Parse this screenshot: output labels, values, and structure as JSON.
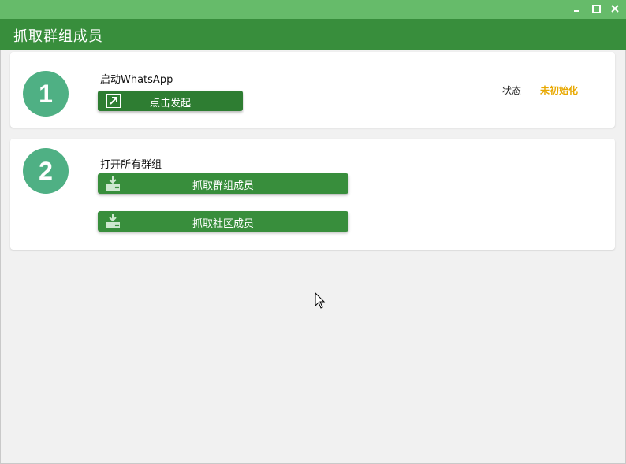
{
  "window": {
    "title_bar_color": "#66bb6a",
    "controls": {
      "minimize_icon": "minimize-icon",
      "maximize_icon": "maximize-icon",
      "close_icon": "close-icon"
    }
  },
  "header": {
    "title": "抓取群组成员",
    "color": "#388e3c"
  },
  "step1": {
    "number": "1",
    "title": "启动WhatsApp",
    "button_label": "点击发起",
    "button_icon": "external-link-icon",
    "status_label": "状态",
    "status_value": "未初始化",
    "status_color": "#e8a800"
  },
  "step2": {
    "number": "2",
    "title": "打开所有群组",
    "buttons": [
      {
        "label": "抓取群组成员",
        "icon": "download-tray-icon"
      },
      {
        "label": "抓取社区成员",
        "icon": "download-tray-icon"
      }
    ]
  },
  "accent_color": "#4fb084"
}
